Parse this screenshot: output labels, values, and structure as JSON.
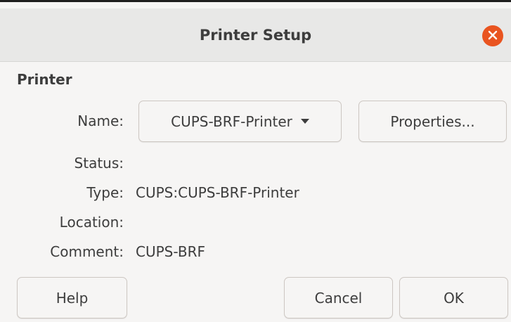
{
  "dialog": {
    "title": "Printer Setup",
    "close_icon": "close-icon"
  },
  "printer": {
    "section_title": "Printer",
    "name_label": "Name:",
    "name_value": "CUPS-BRF-Printer",
    "properties_label": "Properties...",
    "status_label": "Status:",
    "status_value": "",
    "type_label": "Type:",
    "type_value": "CUPS:CUPS-BRF-Printer",
    "location_label": "Location:",
    "location_value": "",
    "comment_label": "Comment:",
    "comment_value": "CUPS-BRF"
  },
  "buttons": {
    "help": "Help",
    "cancel": "Cancel",
    "ok": "OK"
  },
  "colors": {
    "accent": "#e95420",
    "background": "#f6f5f4",
    "titlebar": "#e8e8e7"
  }
}
